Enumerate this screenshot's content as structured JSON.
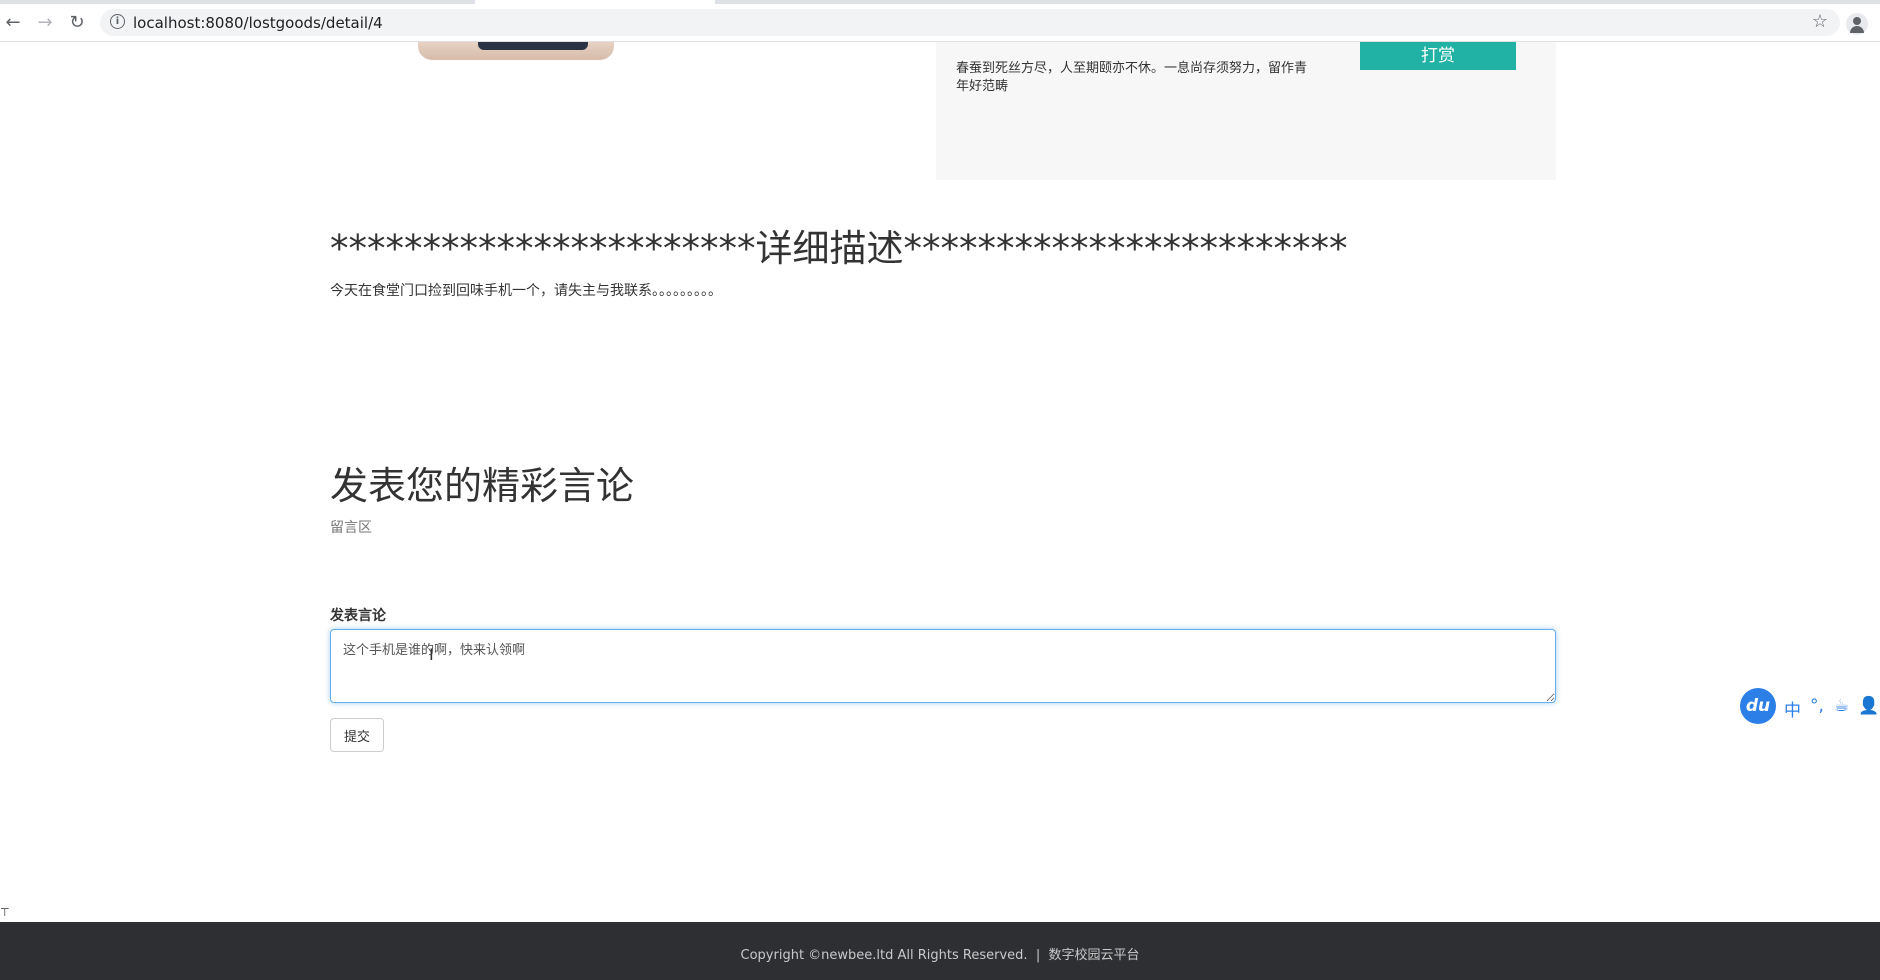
{
  "browser": {
    "url": "localhost:8080/lostgoods/detail/4",
    "icons": [
      "back-arrow-icon",
      "forward-arrow-icon",
      "reload-icon",
      "info-icon",
      "star-icon",
      "profile-icon"
    ]
  },
  "product": {
    "motto": "春蚕到死丝方尽，人至期颐亦不休。一息尚存须努力，留作青年好范畴",
    "reward_label": "打赏"
  },
  "description": {
    "heading": "***********************详细描述************************",
    "text": "今天在食堂门口捡到回味手机一个，请失主与我联系。。。。。。。。。"
  },
  "comments": {
    "title": "发表您的精彩言论",
    "subtitle": "留言区",
    "form_label": "发表言论",
    "textarea_value": "这个手机是谁的啊，快来认领啊",
    "submit_label": "提交"
  },
  "ime": {
    "logo": "du",
    "items": [
      "中",
      "°,",
      "☕",
      "👤"
    ]
  },
  "footer": {
    "copyright": "Copyright ©newbee.ltd All Rights Reserved.",
    "separator": "|",
    "link": "数字校园云平台"
  },
  "colors": {
    "accent": "#22b2a5",
    "footer_bg": "#2d2f33",
    "focus_border": "#66afe9",
    "ime_blue": "#2b7fe6"
  }
}
